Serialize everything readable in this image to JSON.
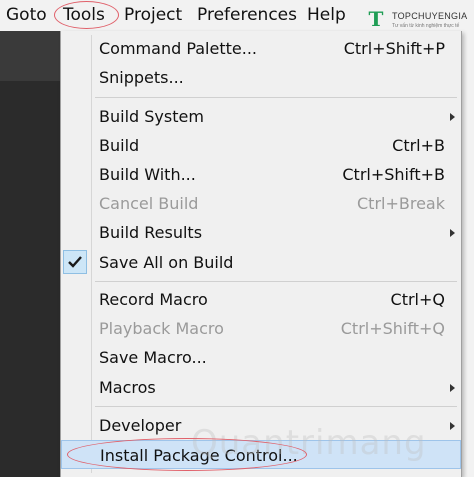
{
  "menubar": {
    "items": [
      {
        "label": "Goto"
      },
      {
        "label": "Tools"
      },
      {
        "label": "Project"
      },
      {
        "label": "Preferences"
      },
      {
        "label": "Help"
      }
    ]
  },
  "logo": {
    "mark": "T",
    "name": "TOPCHUYENGIA",
    "tagline": "Tư vấn từ kinh nghiệm thực tế"
  },
  "tools_menu": {
    "items": [
      {
        "label": "Command Palette...",
        "shortcut": "Ctrl+Shift+P"
      },
      {
        "label": "Snippets...",
        "shortcut": ""
      },
      {
        "label": "Build System",
        "shortcut": "",
        "submenu": true
      },
      {
        "label": "Build",
        "shortcut": "Ctrl+B"
      },
      {
        "label": "Build With...",
        "shortcut": "Ctrl+Shift+B"
      },
      {
        "label": "Cancel Build",
        "shortcut": "Ctrl+Break",
        "disabled": true
      },
      {
        "label": "Build Results",
        "shortcut": "",
        "submenu": true
      },
      {
        "label": "Save All on Build",
        "shortcut": "",
        "checked": true
      },
      {
        "label": "Record Macro",
        "shortcut": "Ctrl+Q"
      },
      {
        "label": "Playback Macro",
        "shortcut": "Ctrl+Shift+Q",
        "disabled": true
      },
      {
        "label": "Save Macro...",
        "shortcut": ""
      },
      {
        "label": "Macros",
        "shortcut": "",
        "submenu": true
      },
      {
        "label": "Developer",
        "shortcut": "",
        "submenu": true
      },
      {
        "label": "Install Package Control...",
        "shortcut": "",
        "highlighted": true
      }
    ]
  },
  "watermark": "Quantrimang",
  "colors": {
    "annotation_circle": "#e0606a",
    "highlight": "#cfe3f7",
    "logo_green": "#1f9d55"
  }
}
